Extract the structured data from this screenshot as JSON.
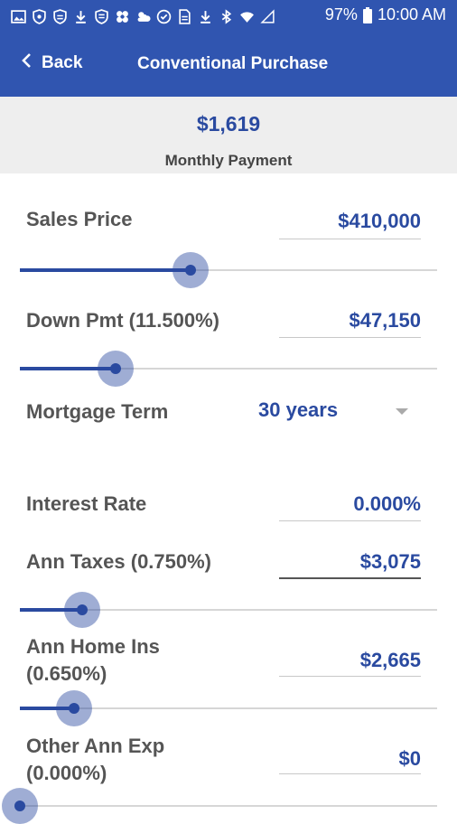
{
  "status_bar": {
    "battery": "97%",
    "time": "10:00 AM",
    "icons": [
      "gallery-icon",
      "shield-icon",
      "shield-icon",
      "download-icon",
      "shield-icon",
      "flower-icon",
      "weather-icon",
      "check-circle-icon",
      "document-icon",
      "download-icon",
      "bluetooth-icon",
      "wifi-icon",
      "signal-icon",
      "battery-icon"
    ]
  },
  "app_bar": {
    "back_label": "Back",
    "title": "Conventional Purchase"
  },
  "summary": {
    "amount": "$1,619",
    "label": "Monthly Payment"
  },
  "colors": {
    "primary": "#3055b0",
    "accent": "#2a4aa0"
  },
  "form": {
    "sales_price": {
      "label": "Sales Price",
      "value": "$410,000",
      "slider_fraction": 0.41
    },
    "down_payment": {
      "label": "Down Pmt (11.500%)",
      "value": "$47,150",
      "slider_fraction": 0.23
    },
    "mortgage_term": {
      "label": "Mortgage Term",
      "value": "30 years"
    },
    "interest_rate": {
      "label": "Interest Rate",
      "value": "0.000%"
    },
    "ann_taxes": {
      "label": "Ann Taxes (0.750%)",
      "value": "$3,075",
      "slider_fraction": 0.15
    },
    "home_ins": {
      "label_line1": "Ann Home Ins",
      "label_line2": "(0.650%)",
      "value": "$2,665",
      "slider_fraction": 0.13
    },
    "other_exp": {
      "label_line1": "Other Ann Exp",
      "label_line2": "(0.000%)",
      "value": "$0",
      "slider_fraction": 0.0
    }
  }
}
